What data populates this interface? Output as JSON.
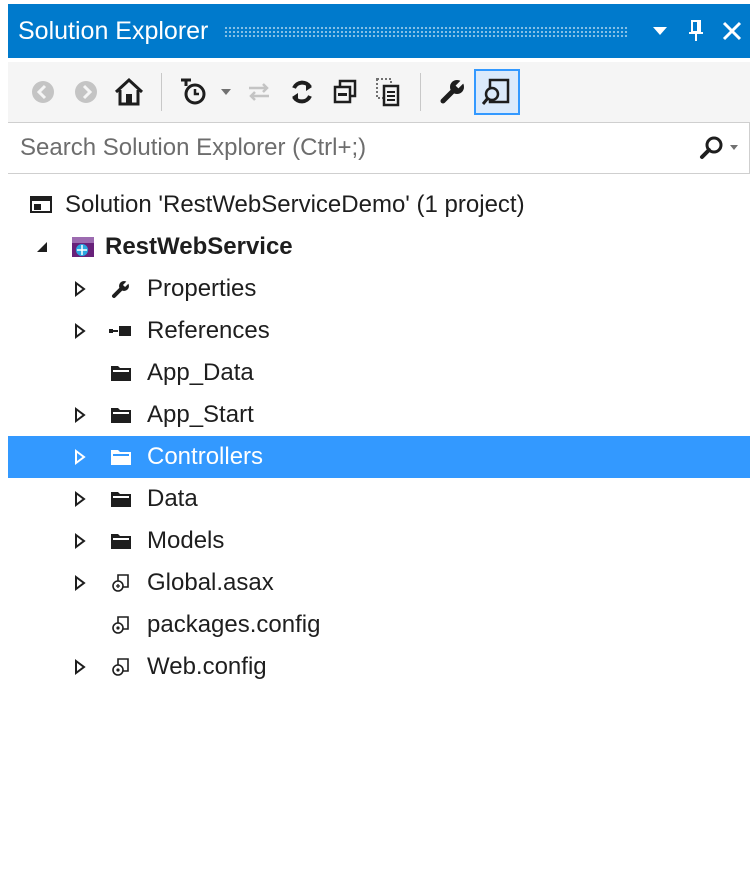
{
  "window": {
    "title": "Solution Explorer"
  },
  "toolbar": {
    "buttons": [
      {
        "name": "back-icon"
      },
      {
        "name": "forward-icon"
      },
      {
        "name": "home-icon"
      },
      {
        "name": "pending-changes-filter-icon"
      },
      {
        "name": "dropdown-arrow-icon"
      },
      {
        "name": "sync-with-active-document-icon"
      },
      {
        "name": "refresh-icon"
      },
      {
        "name": "collapse-all-icon"
      },
      {
        "name": "show-all-files-icon"
      },
      {
        "name": "properties-icon"
      },
      {
        "name": "preview-selected-items-icon"
      }
    ]
  },
  "search": {
    "placeholder": "Search Solution Explorer (Ctrl+;)"
  },
  "tree": {
    "solution": "Solution 'RestWebServiceDemo' (1 project)",
    "project": "RestWebService",
    "items": [
      {
        "label": "Properties",
        "icon": "wrench-icon",
        "expandable": true
      },
      {
        "label": "References",
        "icon": "references-icon",
        "expandable": true
      },
      {
        "label": "App_Data",
        "icon": "folder-icon",
        "expandable": false
      },
      {
        "label": "App_Start",
        "icon": "folder-icon",
        "expandable": true
      },
      {
        "label": "Controllers",
        "icon": "folder-icon",
        "expandable": true,
        "selected": true
      },
      {
        "label": "Data",
        "icon": "folder-icon",
        "expandable": true
      },
      {
        "label": "Models",
        "icon": "folder-icon",
        "expandable": true
      },
      {
        "label": "Global.asax",
        "icon": "asax-file-icon",
        "expandable": true
      },
      {
        "label": "packages.config",
        "icon": "config-file-icon",
        "expandable": false
      },
      {
        "label": "Web.config",
        "icon": "config-file-icon",
        "expandable": true
      }
    ]
  },
  "colors": {
    "accent": "#007acc",
    "selection": "#3399ff",
    "toolbar_bg": "#f5f5f5"
  }
}
